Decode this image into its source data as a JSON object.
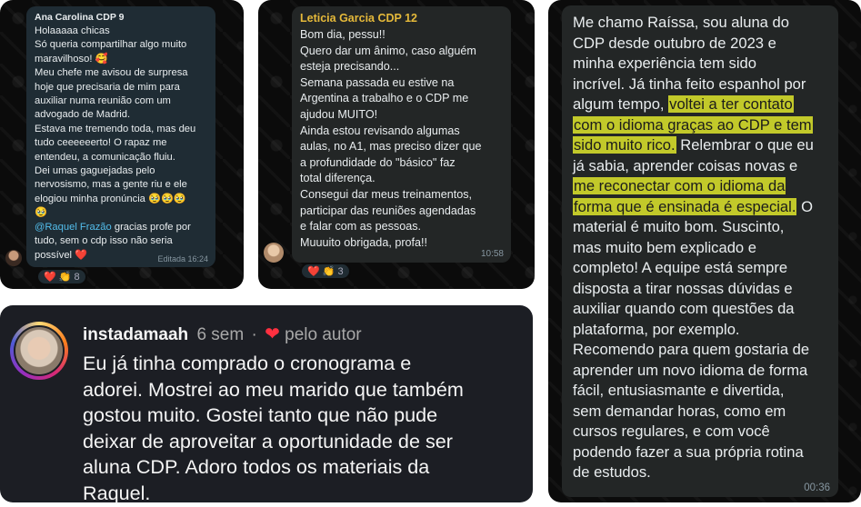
{
  "chat1": {
    "sender": "Ana Carolina CDP 9",
    "lines": [
      "Holaaaaa chicas",
      "Só queria compartilhar algo muito",
      "maravilhoso! 🥰",
      "Meu chefe me avisou de surpresa",
      "hoje que precisaria de mim para",
      "auxiliar numa reunião com um",
      "advogado de Madrid.",
      "Estava me tremendo toda, mas deu",
      "tudo ceeeeeerto! O rapaz me",
      "entendeu, a comunicação fluiu.",
      "Dei umas gaguejadas pelo",
      "nervosismo, mas a gente riu e ele",
      "elogiou minha pronúncia 🥹🥹🥹",
      "🥹"
    ],
    "mention": "@Raquel Frazão",
    "after_mention": " gracias profe por",
    "closing_lines": [
      "tudo, sem o cdp isso não seria",
      "possível ❤️"
    ],
    "edited_time": "Editada 16:24",
    "reactions": "❤️ 👏 8"
  },
  "chat2": {
    "sender": "Leticia Garcia CDP 12",
    "sender_color": "#e5b93a",
    "lines": [
      "Bom dia, pessu!!",
      "Quero dar um ânimo, caso alguém",
      "esteja precisando...",
      "Semana passada eu estive na",
      "Argentina a trabalho e o CDP me",
      "ajudou MUITO!",
      "Ainda estou revisando algumas",
      "aulas, no A1, mas preciso dizer que",
      "a profundidade do \"básico\" faz",
      "total diferença.",
      "Consegui dar meus treinamentos,",
      "participar das reuniões agendadas",
      "e falar com as pessoas.",
      "Muuuito obrigada, profa!!"
    ],
    "time": "10:58",
    "reactions": "❤️ 👏 3"
  },
  "chat3": {
    "segments": [
      {
        "text": "Me chamo Raíssa, sou aluna do\nCDP desde outubro de 2023 e\nminha experiência tem sido\nincrível. Já tinha feito espanhol por\nalgum tempo, ",
        "hl": false
      },
      {
        "text": "voltei a ter contato",
        "hl": true
      },
      {
        "text": "\n",
        "hl": false
      },
      {
        "text": "com o idioma graças ao CDP e tem",
        "hl": true
      },
      {
        "text": "\n",
        "hl": false
      },
      {
        "text": "sido muito rico.",
        "hl": true
      },
      {
        "text": " Relembrar o que eu\njá sabia, aprender coisas novas e\n",
        "hl": false
      },
      {
        "text": "me reconectar com o idioma da",
        "hl": true
      },
      {
        "text": "\n",
        "hl": false
      },
      {
        "text": "forma que é ensinada é especial.",
        "hl": true
      },
      {
        "text": " O\nmaterial é muito bom. Suscinto,\nmas muito bem explicado e\ncompleto! A equipe está sempre\ndisposta a tirar nossas dúvidas e\nauxiliar quando com questões da\nplataforma, por exemplo.\nRecomendo para quem gostaria de\naprender um novo idioma de forma\nfácil, entusiasmante e divertida,\nsem demandar horas, como em\ncursos regulares, e com você\npodendo fazer a sua própria rotina\nde estudos.",
        "hl": false
      }
    ],
    "time": "00:36"
  },
  "comment": {
    "username": "instadamaah",
    "age": "6 sem",
    "separator": "·",
    "liked_by": "pelo autor",
    "text": "Eu já tinha comprado o cronograma e\nadorei. Mostrei ao meu marido que também\ngostou muito. Gostei tanto que não pude\ndeixar de aproveitar a oportunidade de ser\naluna CDP. Adoro todos os materiais da\nRaquel."
  },
  "colors": {
    "highlight": "#c2c92a",
    "heart": "#ff3040",
    "mention": "#53bdeb"
  }
}
